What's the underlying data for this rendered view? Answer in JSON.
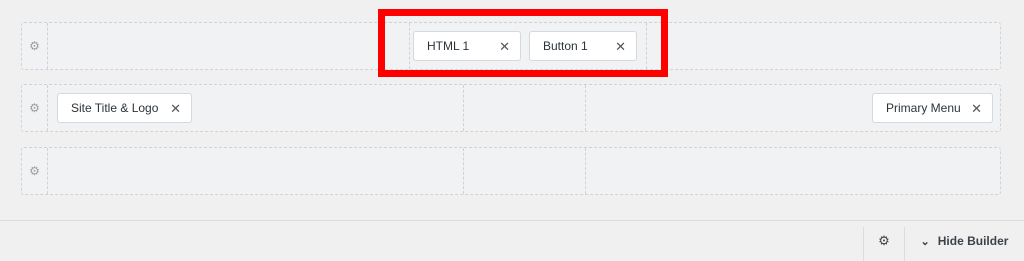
{
  "rows": {
    "top": {
      "items": [
        {
          "label": "HTML 1"
        },
        {
          "label": "Button 1"
        }
      ]
    },
    "main": {
      "items": [
        {
          "label": "Site Title & Logo"
        },
        {
          "label": "Primary Menu"
        }
      ]
    },
    "bottom": {
      "items": []
    }
  },
  "icons": {
    "gear": "gear-icon",
    "close": "close-icon",
    "chevron": "chevron-down-icon"
  },
  "footer": {
    "hide_builder_label": "Hide Builder"
  },
  "colors": {
    "highlight": "#ff0000",
    "item_bg": "#ffffff",
    "row_bg": "#f1f2f3"
  }
}
